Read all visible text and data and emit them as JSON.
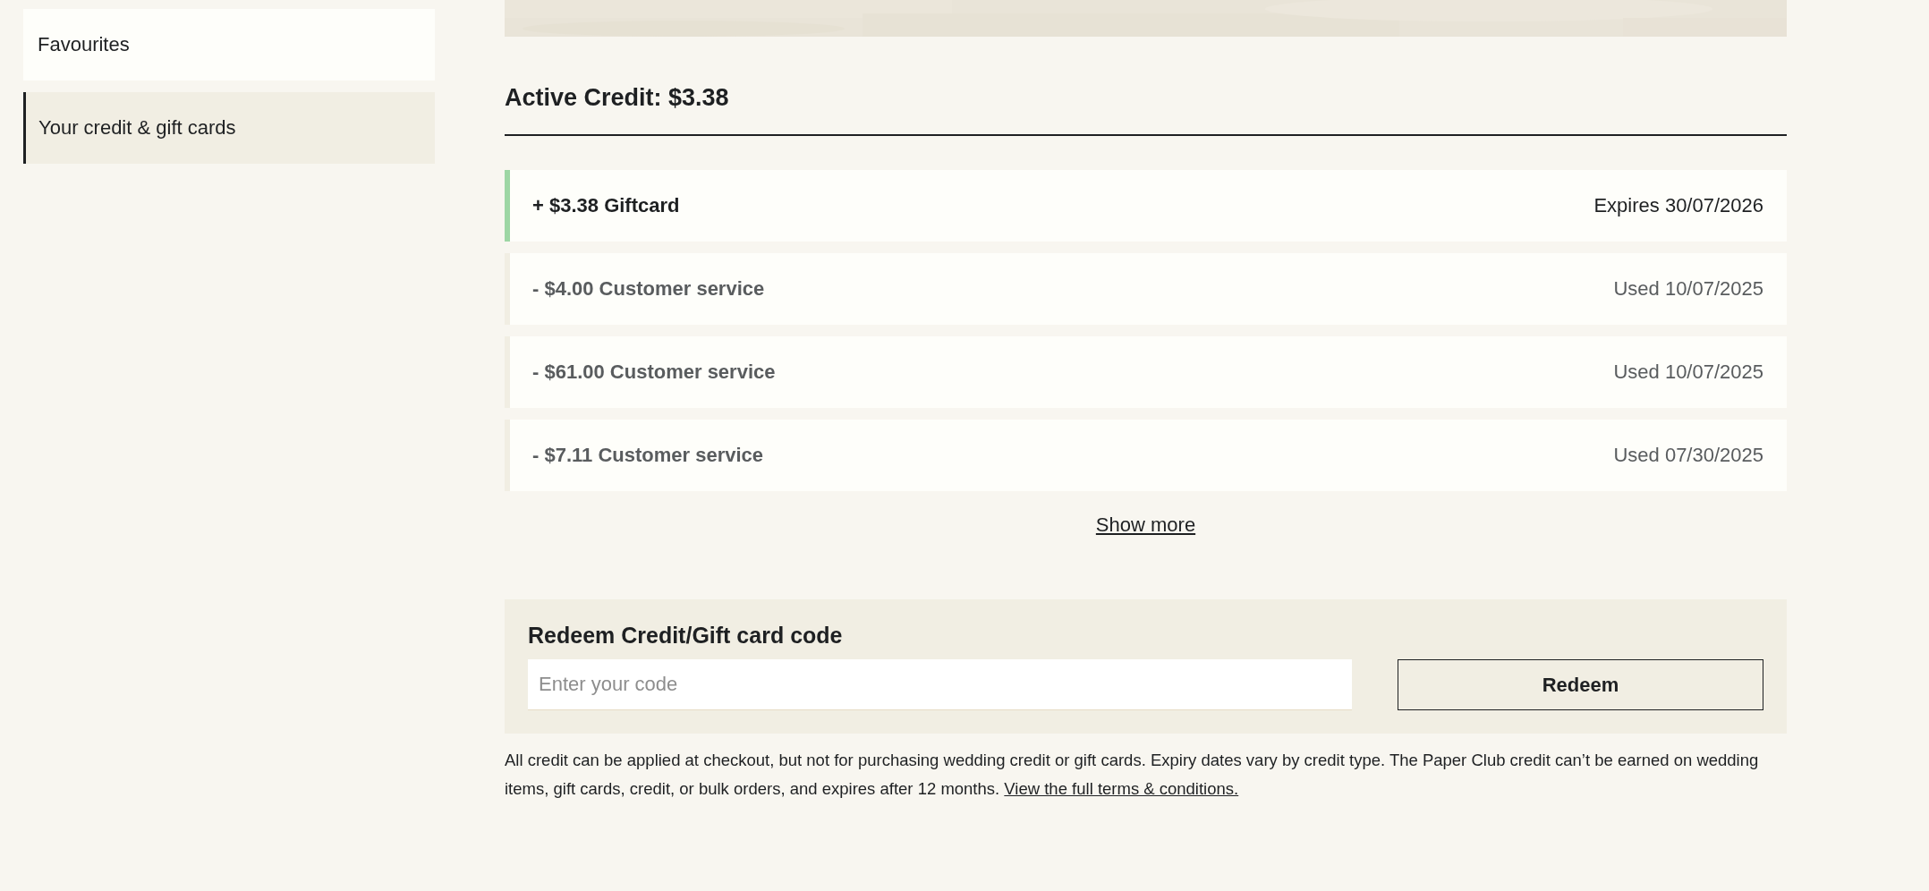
{
  "sidebar": {
    "items": [
      {
        "label": "Favourites",
        "selected": false
      },
      {
        "label": "Your credit & gift cards",
        "selected": true
      }
    ]
  },
  "active_credit": "Active Credit: $3.38",
  "transactions": [
    {
      "kind": "credit",
      "description": "+ $3.38 Giftcard",
      "date": "Expires 30/07/2026"
    },
    {
      "kind": "debit",
      "description": "- $4.00 Customer service",
      "date": "Used 10/07/2025"
    },
    {
      "kind": "debit",
      "description": "- $61.00 Customer service",
      "date": "Used 10/07/2025"
    },
    {
      "kind": "debit",
      "description": "- $7.11 Customer service",
      "date": "Used 07/30/2025"
    }
  ],
  "show_more": "Show more",
  "redeem": {
    "title": "Redeem Credit/Gift card code",
    "placeholder": "Enter your code",
    "button": "Redeem"
  },
  "footnote": {
    "text": "All credit can be applied at checkout, but not for purchasing wedding credit or gift cards. Expiry dates vary by credit type. The Paper Club credit can’t be earned on wedding items, gift cards, credit, or bulk orders, and expires after 12 months.",
    "link": "View the full terms & conditions."
  }
}
